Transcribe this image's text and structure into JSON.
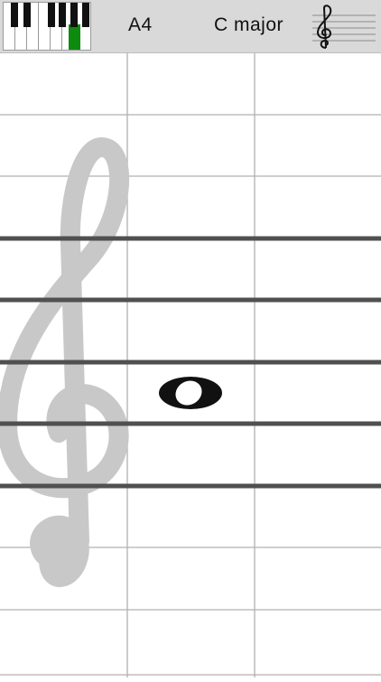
{
  "header": {
    "note": "A4",
    "key": "C major",
    "active_key_index": 5
  },
  "icons": {
    "keyboard": "piano-keyboard-icon",
    "clef_button": "treble-clef-icon",
    "background_clef": "treble-clef-icon",
    "note": "whole-note-icon"
  },
  "colors": {
    "toolbar": "#d9d9d9",
    "active_key": "#0e8a0e",
    "staff_line": "#505050",
    "grid_line": "#b0b0b0",
    "clef": "#c8c8c8",
    "note": "#111111"
  }
}
